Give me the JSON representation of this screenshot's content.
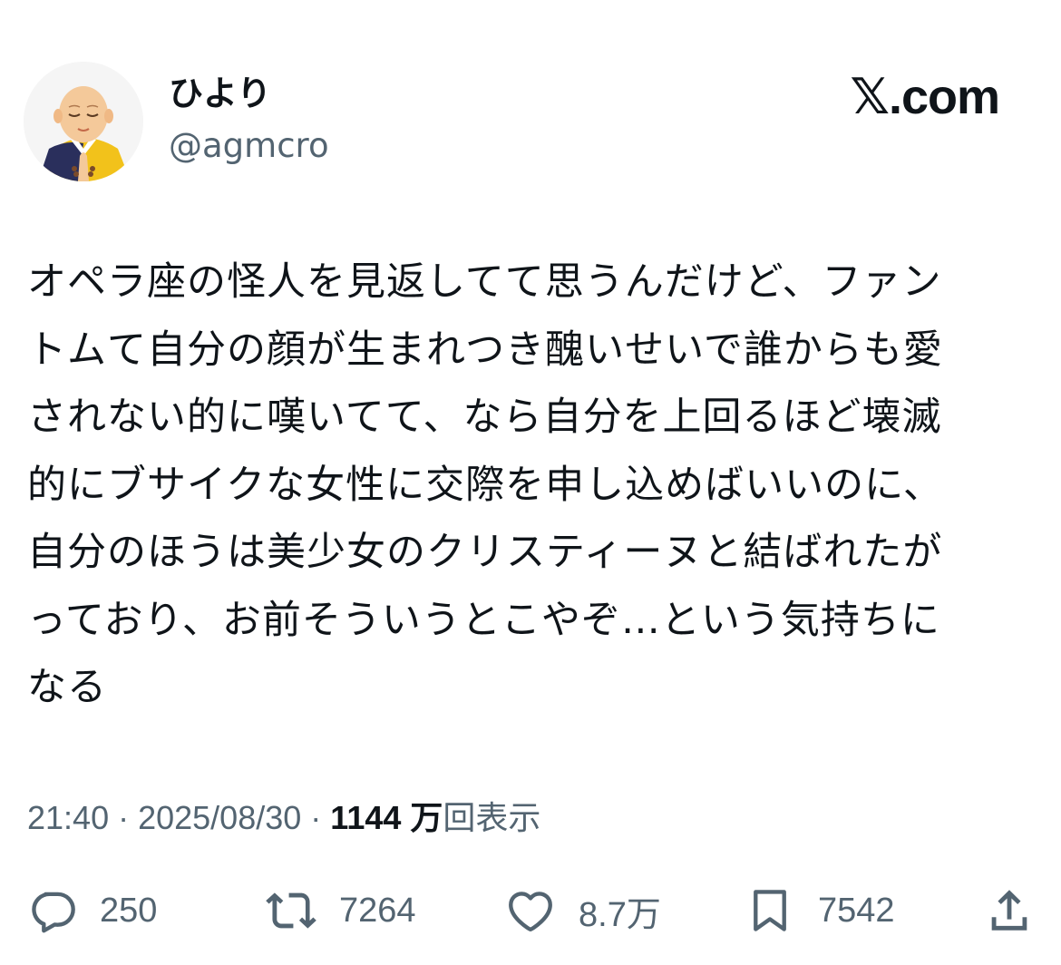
{
  "author": {
    "display_name": "ひより",
    "handle": "@agmcro",
    "avatar_icon": "monk-avatar-icon"
  },
  "site_mark": "𝕏.com",
  "tweet": {
    "lines": [
      "オペラ座の怪人を見返してて思うんだけど、ファン",
      "トムて自分の顔が生まれつき醜いせいで誰からも愛",
      "されない的に嘆いてて、なら自分を上回るほど壊滅",
      "的にブサイクな女性に交際を申し込めばいいのに、",
      "自分のほうは美少女のクリスティーヌと結ばれたが",
      "っており、お前そういうとこやぞ…という気持ちに",
      "なる"
    ]
  },
  "meta": {
    "time": "21:40",
    "separator": " · ",
    "date": "2025/08/30",
    "views_count": "1144 万",
    "views_label": "回表示"
  },
  "actions": {
    "replies": "250",
    "retweets": "7264",
    "likes": "8.7万",
    "bookmarks": "7542"
  },
  "colors": {
    "text": "#0f1419",
    "secondary": "#536471",
    "background": "#ffffff"
  }
}
